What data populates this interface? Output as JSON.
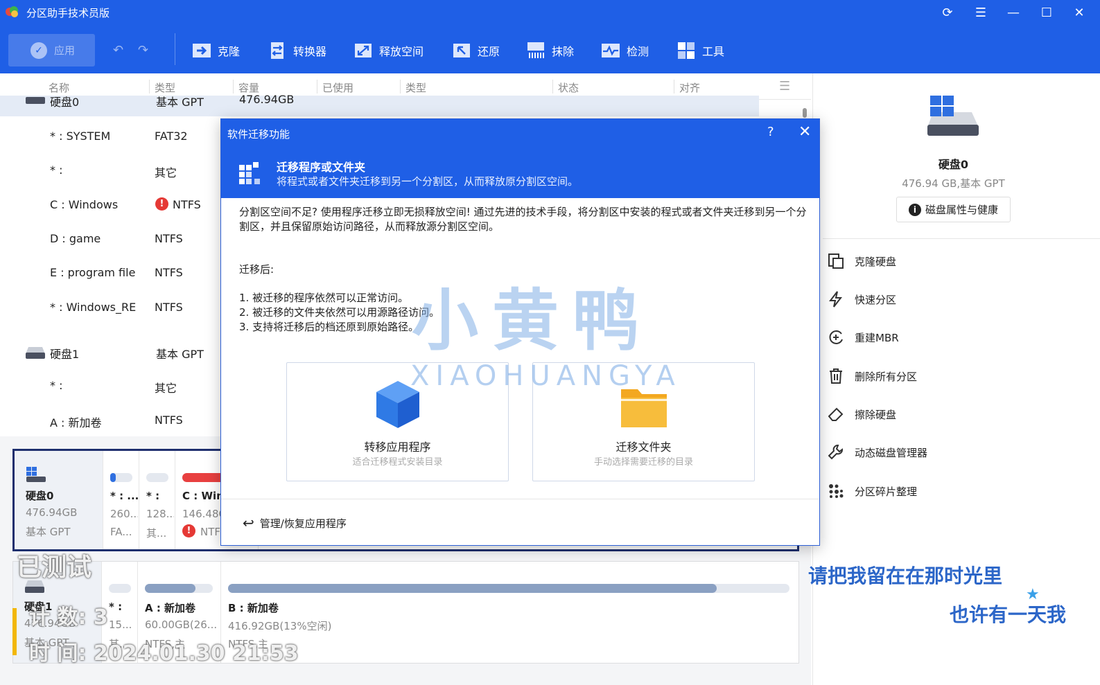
{
  "app": {
    "title": "分区助手技术员版"
  },
  "toolbar": {
    "apply": "应用",
    "items": [
      "克隆",
      "转换器",
      "释放空间",
      "还原",
      "抹除",
      "检测",
      "工具"
    ]
  },
  "columns": [
    "名称",
    "类型",
    "容量",
    "已使用",
    "类型",
    "状态",
    "对齐"
  ],
  "tree": {
    "disk0": {
      "name": "硬盘0",
      "type": "基本 GPT",
      "size": "476.94GB"
    },
    "d0p": [
      {
        "name": "* : SYSTEM",
        "type": "FAT32"
      },
      {
        "name": "* :",
        "type": "其它"
      },
      {
        "name": "C : Windows",
        "type": "NTFS"
      },
      {
        "name": "D : game",
        "type": "NTFS"
      },
      {
        "name": "E : program file",
        "type": "NTFS"
      },
      {
        "name": "* : Windows_RE",
        "type": "NTFS"
      }
    ],
    "disk1": {
      "name": "硬盘1",
      "type": "基本 GPT"
    },
    "d1p": [
      {
        "name": "* :",
        "type": "其它"
      },
      {
        "name": "A : 新加卷",
        "type": "NTFS"
      }
    ]
  },
  "cards": {
    "disk0": {
      "name": "硬盘0",
      "size": "476.94GB",
      "type": "基本 GPT",
      "segs": [
        {
          "l1": "* : ...",
          "l2": "260...",
          "l3": "FA...",
          "fill": 0.25,
          "color": "#2f6fe0"
        },
        {
          "l1": "* :",
          "l2": "128...",
          "l3": "其...",
          "fill": 0,
          "color": "#9db3d8"
        },
        {
          "l1": "C : Win",
          "l2": "146.48G",
          "l3": "NTF",
          "fill": 1,
          "color": "#e84040"
        }
      ]
    },
    "disk1": {
      "name": "硬盘1",
      "size": "476.94GB",
      "type": "基本 GPT",
      "segs": [
        {
          "l1": "* :",
          "l2": "15...",
          "l3": "其...",
          "fill": 0,
          "color": "#9db3d8"
        },
        {
          "l1": "A : 新加卷",
          "l2": "60.00GB(26...",
          "l3": "NTFS,主",
          "fill": 0.74,
          "color": "#8aa0c2"
        },
        {
          "l1": "B : 新加卷",
          "l2": "416.92GB(13%空闲)",
          "l3": "NTFS,主",
          "fill": 0.87,
          "color": "#8aa0c2"
        }
      ]
    }
  },
  "right": {
    "disk": "硬盘0",
    "info": "476.94 GB,基本 GPT",
    "props": "磁盘属性与健康",
    "actions": [
      "克隆硬盘",
      "快速分区",
      "重建MBR",
      "删除所有分区",
      "擦除硬盘",
      "动态磁盘管理器",
      "分区碎片整理"
    ]
  },
  "dialog": {
    "title": "软件迁移功能",
    "help": "?",
    "close": "✕",
    "heading": "迁移程序或文件夹",
    "sub": "将程式或者文件夹迁移到另一个分割区，从而释放原分割区空间。",
    "body": "分割区空间不足? 使用程序迁移立即无损释放空间! 通过先进的技术手段，将分割区中安装的程式或者文件夹迁移到另一个分割区，并且保留原始访问路径，从而释放源分割区空间。",
    "after": "迁移后:",
    "list": [
      "1. 被迁移的程序依然可以正常访问。",
      "2. 被迁移的文件夹依然可以用源路径访问。",
      "3. 支持将迁移后的档还原到原始路径。"
    ],
    "opt1": {
      "title": "转移应用程序",
      "sub": "适合迁移程式安装目录"
    },
    "opt2": {
      "title": "迁移文件夹",
      "sub": "手动选择需要迁移的目录"
    },
    "link": "管理/恢复应用程序"
  },
  "watermark": {
    "cn": "小黄鸭",
    "en": "XIAOHUANGYA"
  },
  "overlay": {
    "tested": "已测试",
    "count": "计  数: 3",
    "time": "时  间: 2024.01.30 21:53",
    "lyric1": "请把我留在在那时光里",
    "lyric2": "也许有一天我"
  },
  "colors": {
    "accent": "#1f5fe6"
  }
}
